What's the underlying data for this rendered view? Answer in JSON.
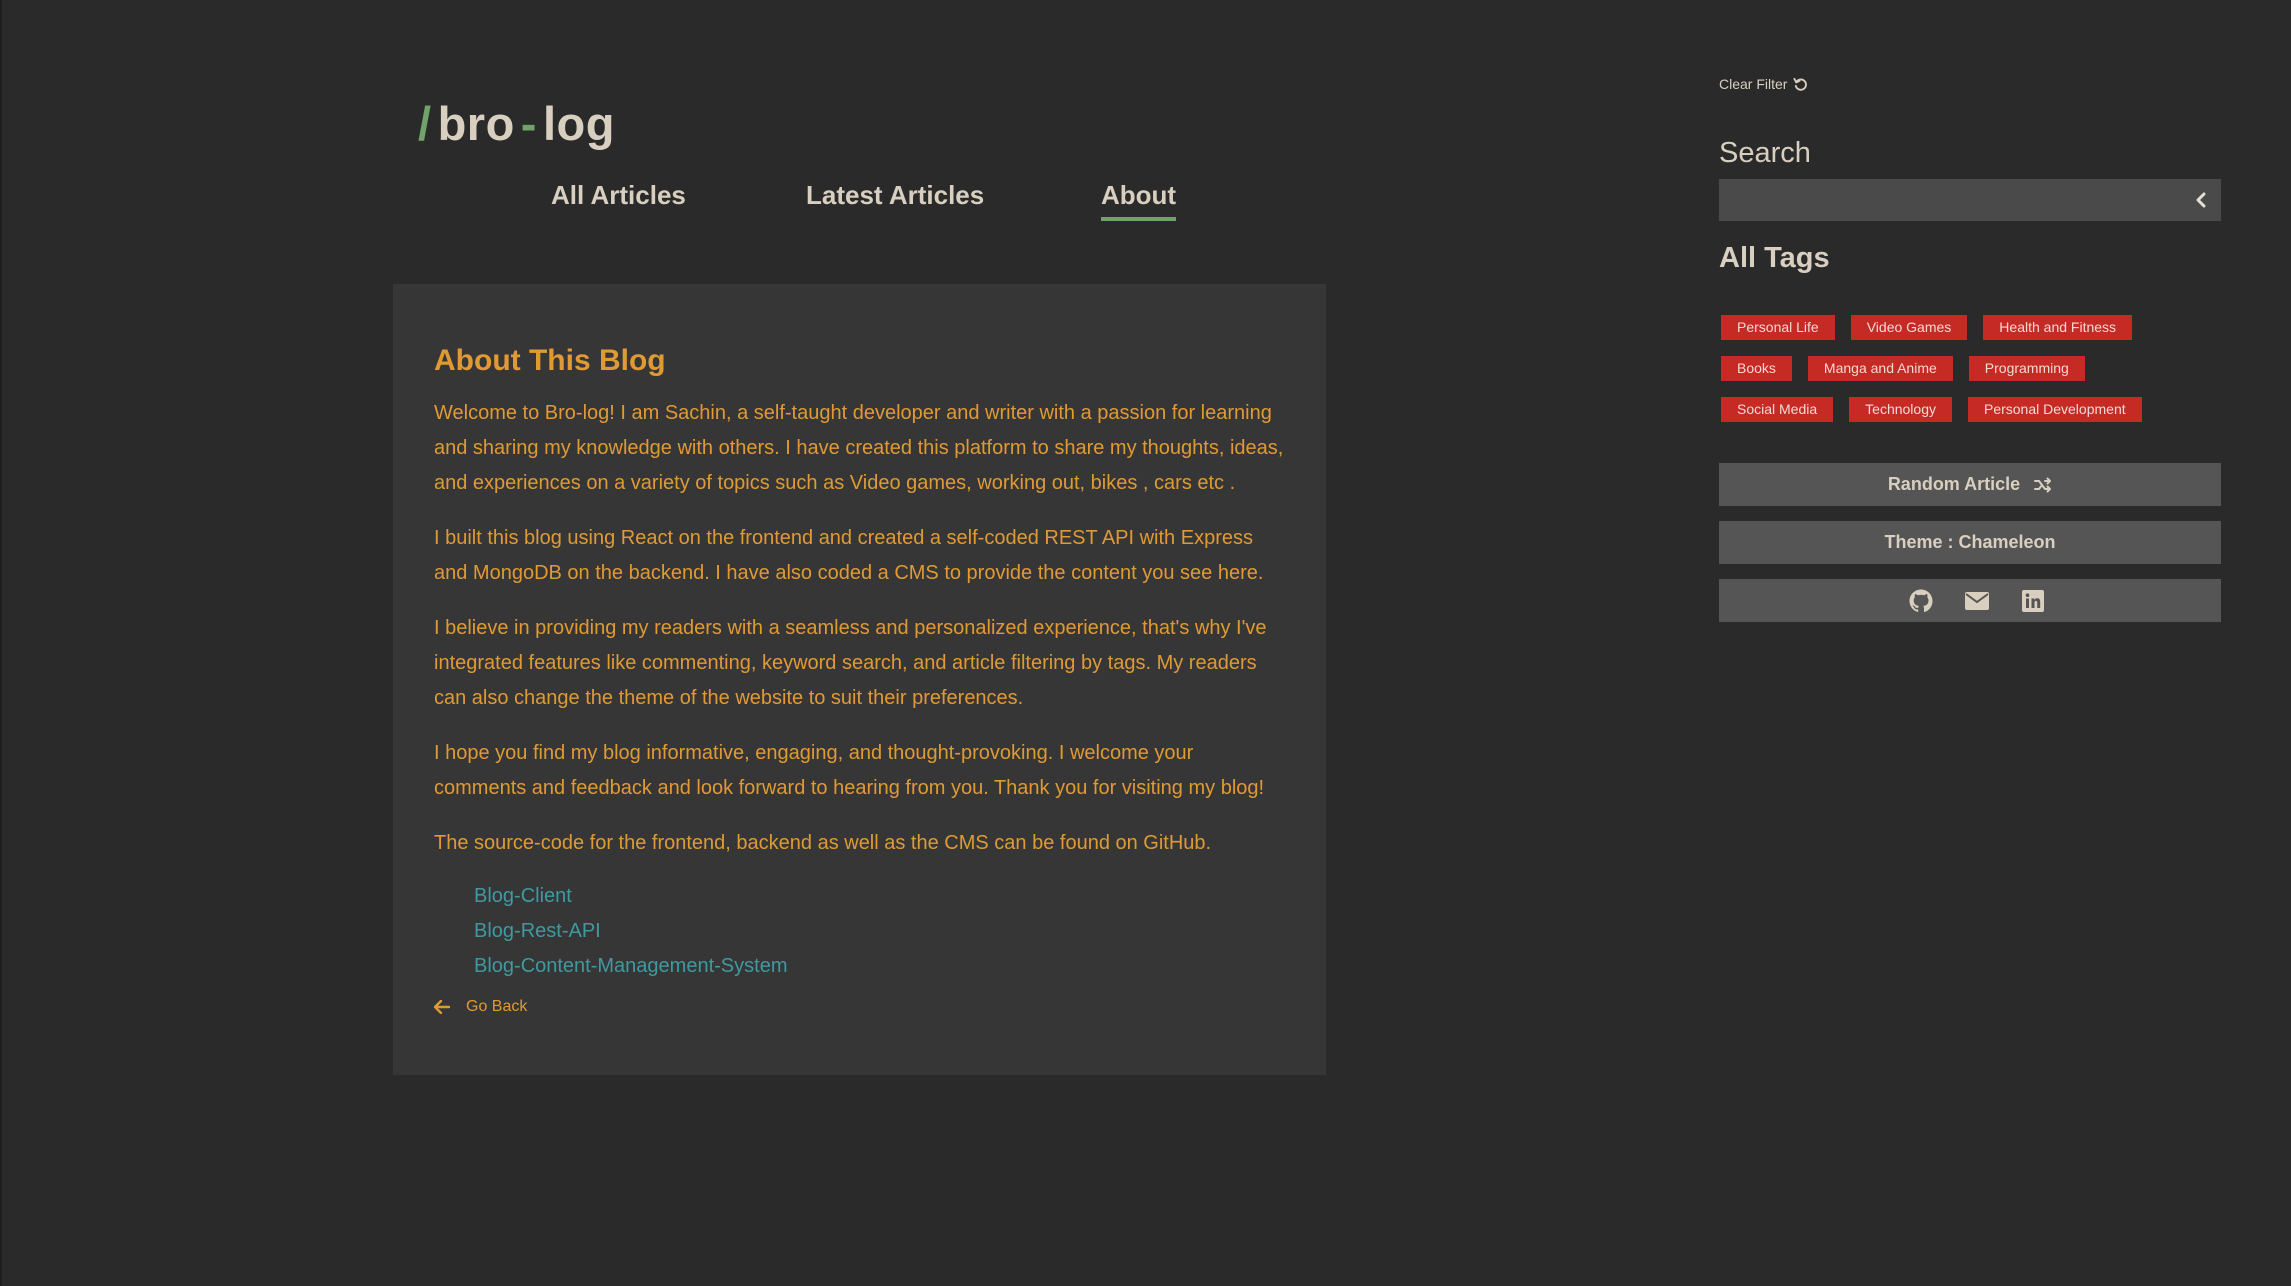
{
  "logo": {
    "slash": "/",
    "part1": "bro",
    "dash": "-",
    "part2": "log"
  },
  "nav": {
    "items": [
      {
        "label": "All Articles"
      },
      {
        "label": "Latest Articles"
      },
      {
        "label": "About",
        "active": true
      }
    ]
  },
  "about": {
    "title": "About This Blog",
    "paragraphs": [
      "Welcome to Bro-log! I am Sachin, a self-taught developer and writer with a passion for learning and sharing my knowledge with others. I have created this platform to share my thoughts, ideas, and experiences on a variety of topics such as Video games, working out, bikes , cars etc .",
      "I built this blog using React on the frontend and created a self-coded REST API with Express and MongoDB on the backend. I have also coded a CMS to provide the content you see here.",
      "I believe in providing my readers with a seamless and personalized experience, that's why I've integrated features like commenting, keyword search, and article filtering by tags. My readers can also change the theme of the website to suit their preferences.",
      "I hope you find my blog informative, engaging, and thought-provoking. I welcome your comments and feedback and look forward to hearing from you. Thank you for visiting my blog!",
      "The source-code for the frontend, backend as well as the CMS can be found on GitHub."
    ],
    "links": [
      "Blog-Client",
      "Blog-Rest-API",
      "Blog-Content-Management-System"
    ],
    "go_back": "Go Back"
  },
  "sidebar": {
    "clear_filter": "Clear Filter",
    "search_title": "Search",
    "search_value": "",
    "tags_title": "All Tags",
    "tags": [
      [
        "Personal Life",
        "Video Games",
        "Health and Fitness"
      ],
      [
        "Books",
        "Manga and Anime",
        "Programming"
      ],
      [
        "Social Media",
        "Technology",
        "Personal Development"
      ]
    ],
    "random_article": "Random Article",
    "theme": "Theme : Chameleon",
    "social_icons": [
      "github-icon",
      "email-icon",
      "linkedin-icon"
    ]
  },
  "colors": {
    "background": "#2a2a2a",
    "card": "#363636",
    "accent_orange": "#e09a34",
    "accent_green": "#6fa36a",
    "link_teal": "#3f9aa0",
    "tag_red": "#c62a24"
  }
}
